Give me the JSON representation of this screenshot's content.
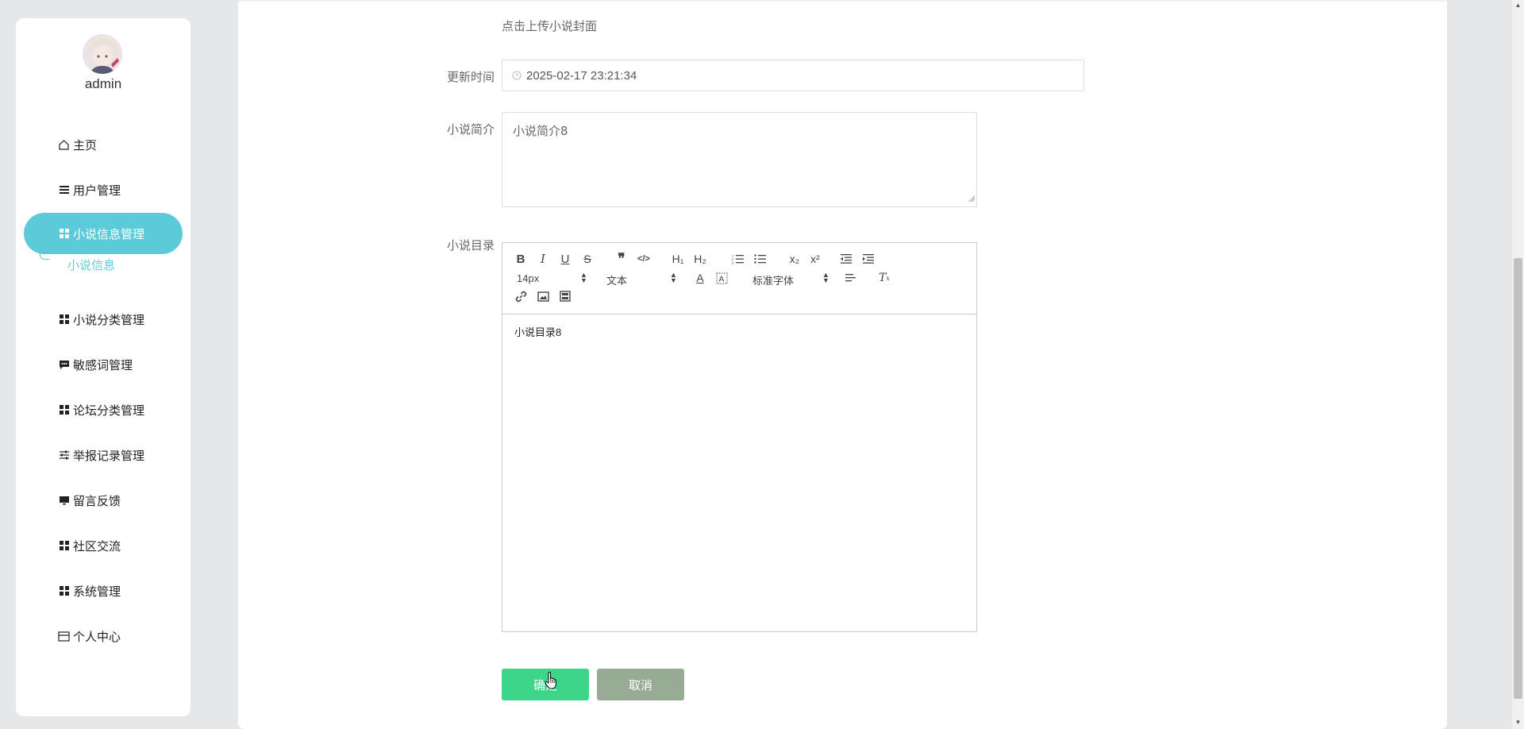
{
  "sidebar": {
    "username": "admin",
    "items": [
      {
        "label": "主页",
        "icon": "home-icon"
      },
      {
        "label": "用户管理",
        "icon": "list-icon"
      },
      {
        "label": "小说信息管理",
        "icon": "grid-icon"
      },
      {
        "label": "小说分类管理",
        "icon": "grid-icon"
      },
      {
        "label": "敏感词管理",
        "icon": "chat-icon"
      },
      {
        "label": "论坛分类管理",
        "icon": "grid-icon"
      },
      {
        "label": "举报记录管理",
        "icon": "sliders-icon"
      },
      {
        "label": "留言反馈",
        "icon": "monitor-icon"
      },
      {
        "label": "社区交流",
        "icon": "grid-icon"
      },
      {
        "label": "系统管理",
        "icon": "grid-icon"
      },
      {
        "label": "个人中心",
        "icon": "card-icon"
      }
    ],
    "submenu": {
      "label": "小说信息"
    },
    "active_color": "#5ccbd9"
  },
  "form": {
    "upload_hint": "点击上传小说封面",
    "update_time": {
      "label": "更新时间",
      "value": "2025-02-17 23:21:34"
    },
    "intro": {
      "label": "小说简介",
      "placeholder": "小说简介8"
    },
    "catalog": {
      "label": "小说目录",
      "font_size": "14px",
      "text_type": "文本",
      "font_family": "标准字体",
      "content": "小说目录8"
    },
    "confirm_label": "确定",
    "cancel_label": "取消",
    "confirm_color": "#3dd689",
    "cancel_color": "#98ab94"
  }
}
